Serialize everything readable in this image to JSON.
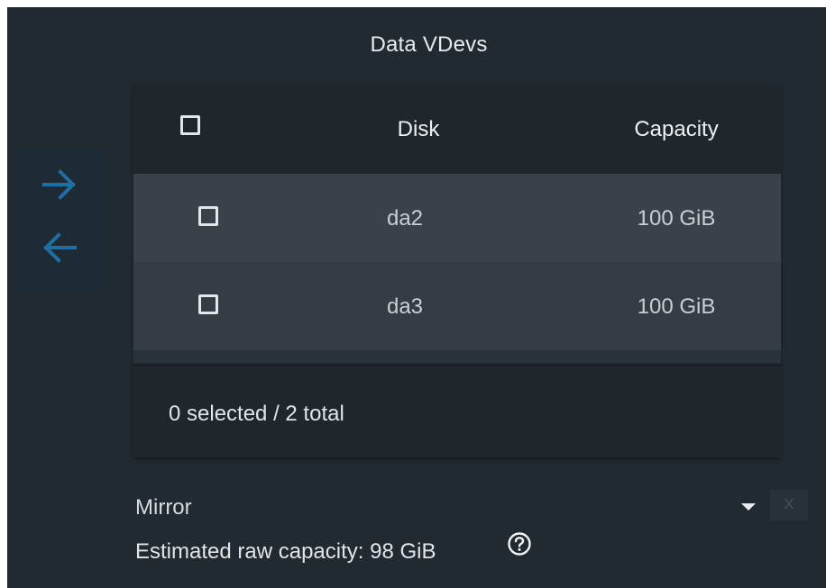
{
  "section": {
    "title": "Data VDevs"
  },
  "transfer": {
    "add_icon": "arrow-right-icon",
    "remove_icon": "arrow-left-icon",
    "icon_color": "#1f6fa3"
  },
  "table": {
    "columns": [
      "Disk",
      "Capacity"
    ],
    "rows": [
      {
        "disk": "da2",
        "capacity": "100 GiB",
        "selected": false
      },
      {
        "disk": "da3",
        "capacity": "100 GiB",
        "selected": false
      }
    ],
    "footer": "0 selected / 2 total"
  },
  "vdev": {
    "type": "Mirror",
    "remove_label": "X",
    "estimated_capacity": "Estimated raw capacity: 98 GiB",
    "help_icon": "help-circle-icon"
  }
}
